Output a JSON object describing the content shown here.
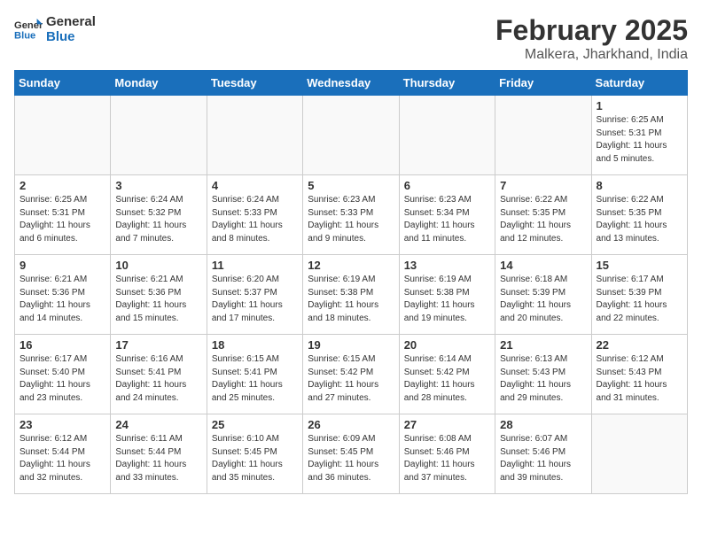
{
  "logo": {
    "line1": "General",
    "line2": "Blue"
  },
  "title": "February 2025",
  "location": "Malkera, Jharkhand, India",
  "weekdays": [
    "Sunday",
    "Monday",
    "Tuesday",
    "Wednesday",
    "Thursday",
    "Friday",
    "Saturday"
  ],
  "weeks": [
    [
      {
        "day": "",
        "info": ""
      },
      {
        "day": "",
        "info": ""
      },
      {
        "day": "",
        "info": ""
      },
      {
        "day": "",
        "info": ""
      },
      {
        "day": "",
        "info": ""
      },
      {
        "day": "",
        "info": ""
      },
      {
        "day": "1",
        "info": "Sunrise: 6:25 AM\nSunset: 5:31 PM\nDaylight: 11 hours\nand 5 minutes."
      }
    ],
    [
      {
        "day": "2",
        "info": "Sunrise: 6:25 AM\nSunset: 5:31 PM\nDaylight: 11 hours\nand 6 minutes."
      },
      {
        "day": "3",
        "info": "Sunrise: 6:24 AM\nSunset: 5:32 PM\nDaylight: 11 hours\nand 7 minutes."
      },
      {
        "day": "4",
        "info": "Sunrise: 6:24 AM\nSunset: 5:33 PM\nDaylight: 11 hours\nand 8 minutes."
      },
      {
        "day": "5",
        "info": "Sunrise: 6:23 AM\nSunset: 5:33 PM\nDaylight: 11 hours\nand 9 minutes."
      },
      {
        "day": "6",
        "info": "Sunrise: 6:23 AM\nSunset: 5:34 PM\nDaylight: 11 hours\nand 11 minutes."
      },
      {
        "day": "7",
        "info": "Sunrise: 6:22 AM\nSunset: 5:35 PM\nDaylight: 11 hours\nand 12 minutes."
      },
      {
        "day": "8",
        "info": "Sunrise: 6:22 AM\nSunset: 5:35 PM\nDaylight: 11 hours\nand 13 minutes."
      }
    ],
    [
      {
        "day": "9",
        "info": "Sunrise: 6:21 AM\nSunset: 5:36 PM\nDaylight: 11 hours\nand 14 minutes."
      },
      {
        "day": "10",
        "info": "Sunrise: 6:21 AM\nSunset: 5:36 PM\nDaylight: 11 hours\nand 15 minutes."
      },
      {
        "day": "11",
        "info": "Sunrise: 6:20 AM\nSunset: 5:37 PM\nDaylight: 11 hours\nand 17 minutes."
      },
      {
        "day": "12",
        "info": "Sunrise: 6:19 AM\nSunset: 5:38 PM\nDaylight: 11 hours\nand 18 minutes."
      },
      {
        "day": "13",
        "info": "Sunrise: 6:19 AM\nSunset: 5:38 PM\nDaylight: 11 hours\nand 19 minutes."
      },
      {
        "day": "14",
        "info": "Sunrise: 6:18 AM\nSunset: 5:39 PM\nDaylight: 11 hours\nand 20 minutes."
      },
      {
        "day": "15",
        "info": "Sunrise: 6:17 AM\nSunset: 5:39 PM\nDaylight: 11 hours\nand 22 minutes."
      }
    ],
    [
      {
        "day": "16",
        "info": "Sunrise: 6:17 AM\nSunset: 5:40 PM\nDaylight: 11 hours\nand 23 minutes."
      },
      {
        "day": "17",
        "info": "Sunrise: 6:16 AM\nSunset: 5:41 PM\nDaylight: 11 hours\nand 24 minutes."
      },
      {
        "day": "18",
        "info": "Sunrise: 6:15 AM\nSunset: 5:41 PM\nDaylight: 11 hours\nand 25 minutes."
      },
      {
        "day": "19",
        "info": "Sunrise: 6:15 AM\nSunset: 5:42 PM\nDaylight: 11 hours\nand 27 minutes."
      },
      {
        "day": "20",
        "info": "Sunrise: 6:14 AM\nSunset: 5:42 PM\nDaylight: 11 hours\nand 28 minutes."
      },
      {
        "day": "21",
        "info": "Sunrise: 6:13 AM\nSunset: 5:43 PM\nDaylight: 11 hours\nand 29 minutes."
      },
      {
        "day": "22",
        "info": "Sunrise: 6:12 AM\nSunset: 5:43 PM\nDaylight: 11 hours\nand 31 minutes."
      }
    ],
    [
      {
        "day": "23",
        "info": "Sunrise: 6:12 AM\nSunset: 5:44 PM\nDaylight: 11 hours\nand 32 minutes."
      },
      {
        "day": "24",
        "info": "Sunrise: 6:11 AM\nSunset: 5:44 PM\nDaylight: 11 hours\nand 33 minutes."
      },
      {
        "day": "25",
        "info": "Sunrise: 6:10 AM\nSunset: 5:45 PM\nDaylight: 11 hours\nand 35 minutes."
      },
      {
        "day": "26",
        "info": "Sunrise: 6:09 AM\nSunset: 5:45 PM\nDaylight: 11 hours\nand 36 minutes."
      },
      {
        "day": "27",
        "info": "Sunrise: 6:08 AM\nSunset: 5:46 PM\nDaylight: 11 hours\nand 37 minutes."
      },
      {
        "day": "28",
        "info": "Sunrise: 6:07 AM\nSunset: 5:46 PM\nDaylight: 11 hours\nand 39 minutes."
      },
      {
        "day": "",
        "info": ""
      }
    ]
  ]
}
